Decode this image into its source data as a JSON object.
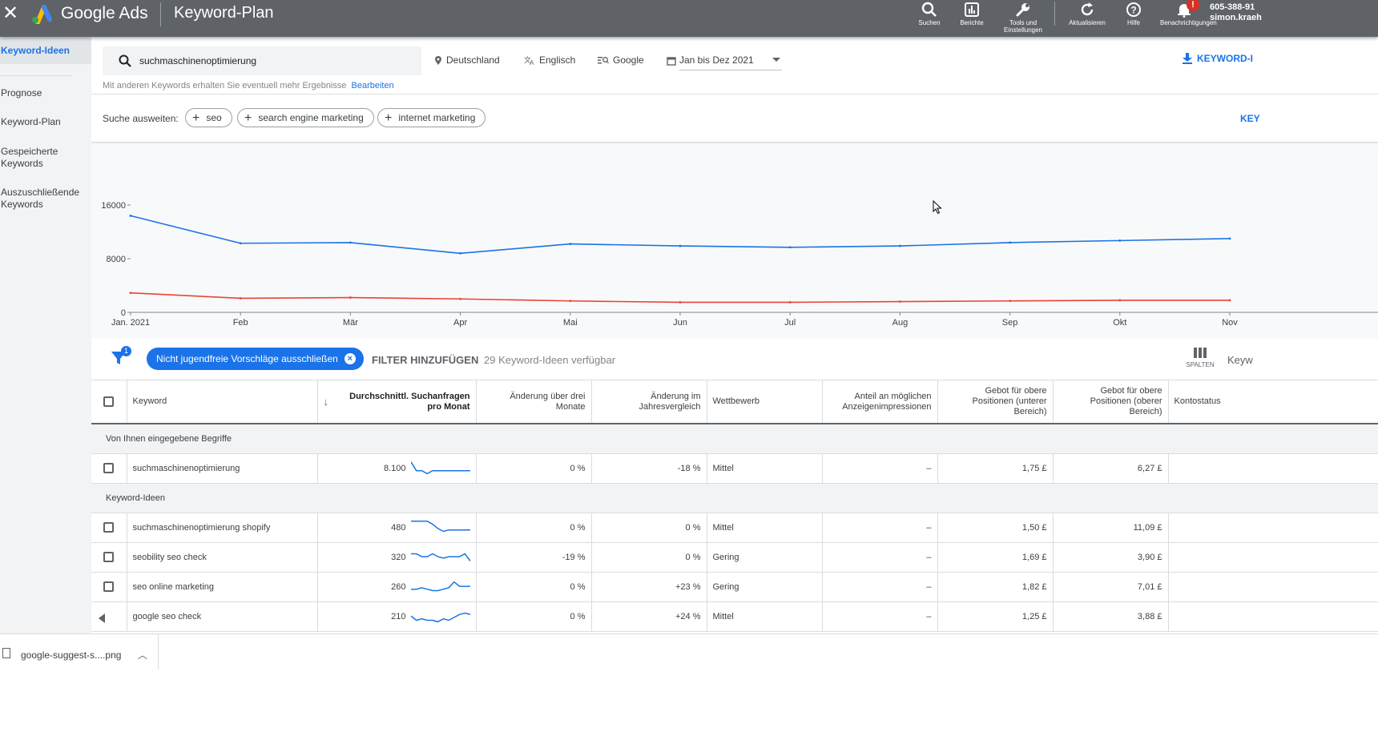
{
  "appbar": {
    "close_icon": "close-icon",
    "brand": "Google Ads",
    "page_title": "Keyword-Plan",
    "tools": [
      {
        "name": "search",
        "label": "Suchen",
        "icon": "search-icon"
      },
      {
        "name": "reports",
        "label": "Berichte",
        "icon": "bar-chart-icon"
      },
      {
        "name": "tools",
        "label": "Tools und Einstellungen",
        "icon": "wrench-icon"
      },
      {
        "name": "refresh",
        "label": "Aktualisieren",
        "icon": "refresh-icon"
      },
      {
        "name": "help",
        "label": "Hilfe",
        "icon": "help-icon"
      },
      {
        "name": "notifications",
        "label": "Benachrichtigungen",
        "icon": "bell-icon"
      }
    ],
    "notification_badge": "!",
    "account_id": "605-388-91",
    "account_user": "simon.kraeh"
  },
  "sidebar": {
    "items": [
      {
        "label": "Keyword-Ideen",
        "active": true
      },
      {
        "label": "Prognose"
      },
      {
        "label": "Keyword-Plan"
      },
      {
        "label": "Gespeicherte Keywords"
      },
      {
        "label": "Auszuschließende Keywords"
      }
    ]
  },
  "search": {
    "value": "suchmaschinenoptimierung",
    "location": "Deutschland",
    "language": "Englisch",
    "network": "Google",
    "date_range": "Jan bis Dez 2021",
    "hint": "Mit anderen Keywords erhalten Sie eventuell mehr Ergebnisse",
    "hint_link": "Bearbeiten",
    "download_label": "KEYWORD-I"
  },
  "expand": {
    "label": "Suche ausweiten:",
    "chips": [
      "seo",
      "search engine marketing",
      "internet marketing"
    ],
    "right_link": "KEY"
  },
  "chart_data": {
    "type": "line",
    "categories": [
      "Jan. 2021",
      "Feb",
      "Mär",
      "Apr",
      "Mai",
      "Jun",
      "Jul",
      "Aug",
      "Sep",
      "Okt",
      "Nov"
    ],
    "yticks": [
      "0",
      "8000",
      "16000"
    ],
    "ylim": [
      0,
      16000
    ],
    "series": [
      {
        "color": "#1a73e8",
        "values": [
          14400,
          10300,
          10400,
          8800,
          10200,
          9900,
          9700,
          9900,
          10400,
          10700,
          11000
        ]
      },
      {
        "color": "#ea4335",
        "values": [
          2900,
          2100,
          2200,
          2000,
          1700,
          1500,
          1500,
          1600,
          1700,
          1800,
          1800
        ]
      }
    ]
  },
  "filter": {
    "badge": "1",
    "active_chip": "Nicht jugendfreie Vorschläge ausschließen",
    "add_filter": "FILTER HINZUFÜGEN",
    "available": "29 Keyword-Ideen verfügbar",
    "columns_label": "SPALTEN",
    "right_trunc": "Keyw"
  },
  "table": {
    "headers": {
      "keyword": "Keyword",
      "volume": "Durchschnittl. Suchanfragen pro Monat",
      "three_month": "Änderung über drei Monate",
      "yoy": "Änderung im Jahresvergleich",
      "competition": "Wettbewerb",
      "impression_share": "Anteil an möglichen Anzeigenimpressionen",
      "bid_low": "Gebot für obere Positionen (unterer Bereich)",
      "bid_high": "Gebot für obere Positionen (oberer Bereich)",
      "account_status": "Kontostatus"
    },
    "group_provided": "Von Ihnen eingegebene Begriffe",
    "group_ideas": "Keyword-Ideen",
    "provided_rows": [
      {
        "keyword": "suchmaschinenoptimierung",
        "volume": "8.100",
        "three_month": "0 %",
        "yoy": "-18 %",
        "competition": "Mittel",
        "impression_share": "–",
        "bid_low": "1,75 £",
        "bid_high": "6,27 £",
        "trend": [
          10,
          4,
          4,
          2,
          4,
          4,
          4,
          4,
          4,
          4,
          4,
          4
        ]
      }
    ],
    "idea_rows": [
      {
        "keyword": "suchmaschinenoptimierung shopify",
        "volume": "480",
        "three_month": "0 %",
        "yoy": "0 %",
        "competition": "Mittel",
        "impression_share": "–",
        "bid_low": "1,50 £",
        "bid_high": "11,09 £",
        "trend": [
          10,
          10,
          10,
          10,
          8,
          5,
          3,
          4,
          4,
          4,
          4,
          4
        ]
      },
      {
        "keyword": "seobility seo check",
        "volume": "320",
        "three_month": "-19 %",
        "yoy": "0 %",
        "competition": "Gering",
        "impression_share": "–",
        "bid_low": "1,69 £",
        "bid_high": "3,90 £",
        "trend": [
          8,
          8,
          6,
          6,
          8,
          6,
          5,
          6,
          6,
          6,
          8,
          3
        ]
      },
      {
        "keyword": "seo online marketing",
        "volume": "260",
        "three_month": "0 %",
        "yoy": "+23 %",
        "competition": "Gering",
        "impression_share": "–",
        "bid_low": "1,82 £",
        "bid_high": "7,01 £",
        "trend": [
          4,
          4,
          5,
          4,
          3,
          3,
          4,
          5,
          9,
          6,
          6,
          6
        ]
      },
      {
        "keyword": "google seo check",
        "volume": "210",
        "three_month": "0 %",
        "yoy": "+24 %",
        "competition": "Mittel",
        "impression_share": "–",
        "bid_low": "1,25 £",
        "bid_high": "3,88 £",
        "trend": [
          6,
          3,
          4,
          3,
          3,
          2,
          4,
          3,
          5,
          7,
          8,
          7
        ]
      }
    ]
  },
  "downloads": {
    "file": "google-suggest-s....png"
  }
}
